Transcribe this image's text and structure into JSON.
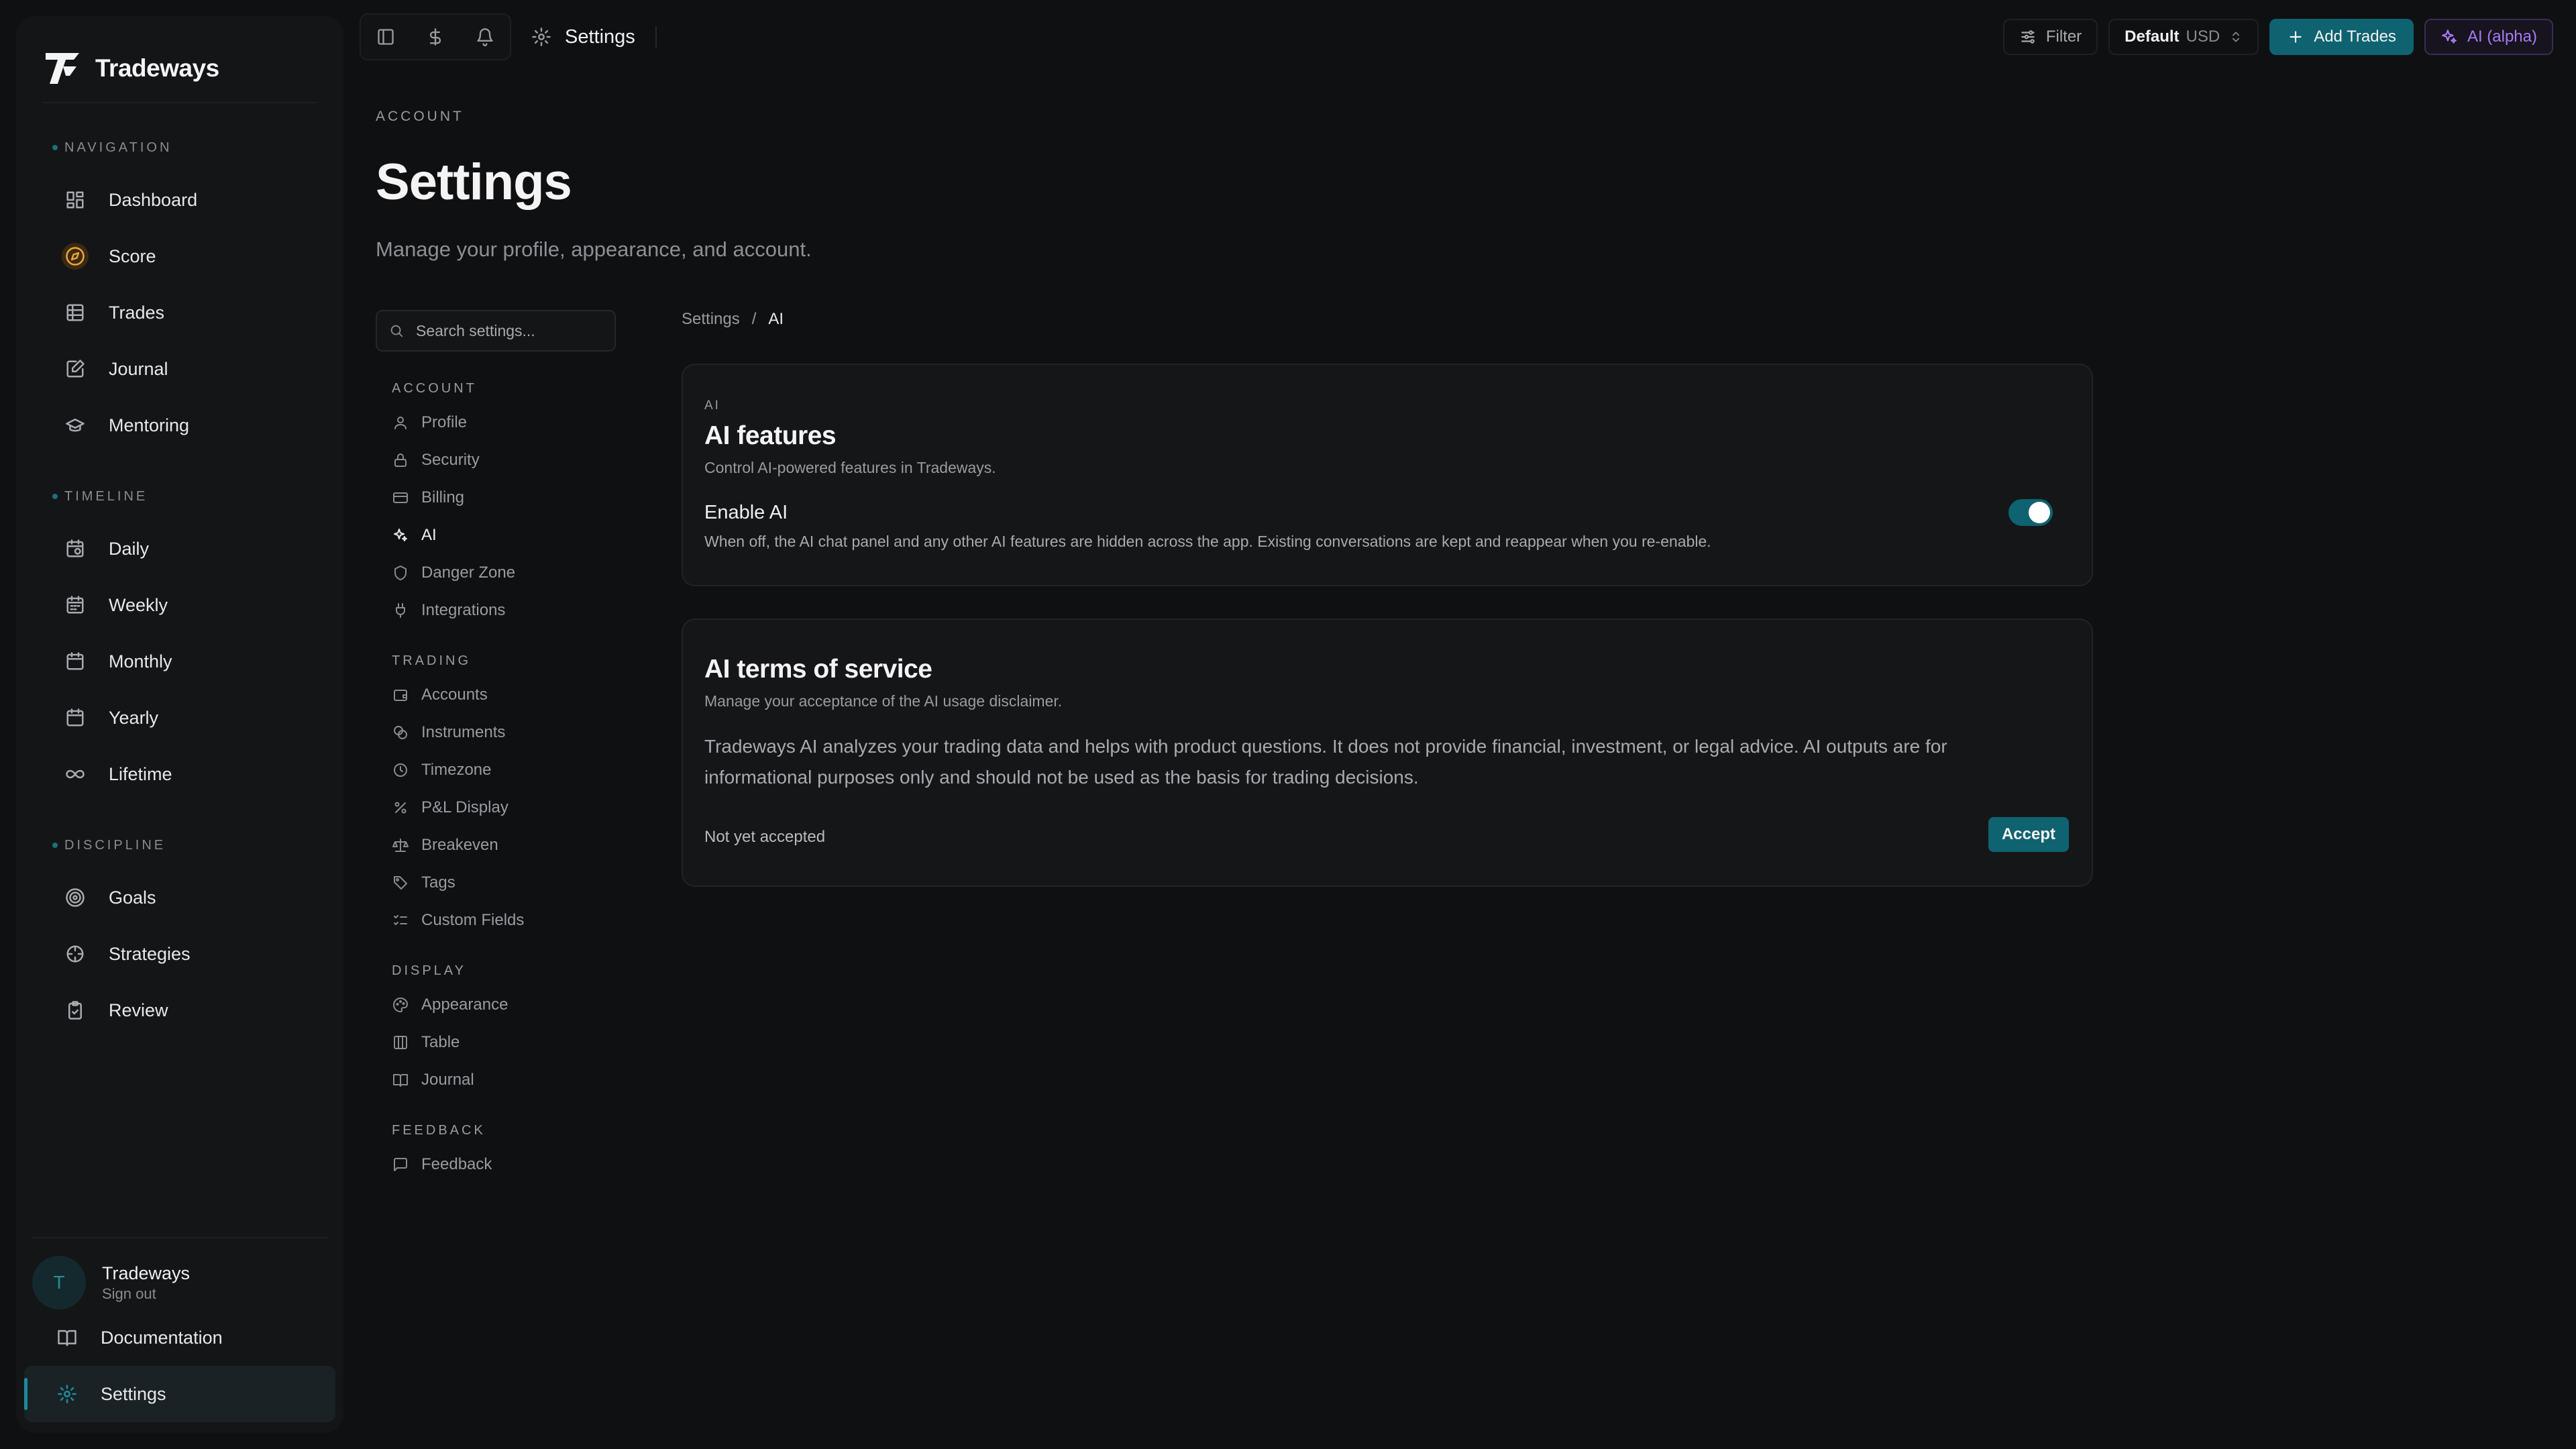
{
  "brand": {
    "name": "Tradeways",
    "accent": "#1f8e9e"
  },
  "sidebar": {
    "sections": [
      {
        "label": "NAVIGATION",
        "items": [
          {
            "label": "Dashboard",
            "icon": "dashboard-icon"
          },
          {
            "label": "Score",
            "icon": "compass-icon",
            "color": "#f0a43a"
          },
          {
            "label": "Trades",
            "icon": "table-icon"
          },
          {
            "label": "Journal",
            "icon": "journal-icon"
          },
          {
            "label": "Mentoring",
            "icon": "graduation-cap-icon"
          }
        ]
      },
      {
        "label": "TIMELINE",
        "items": [
          {
            "label": "Daily",
            "icon": "calendar-clock-icon"
          },
          {
            "label": "Weekly",
            "icon": "calendar-icon"
          },
          {
            "label": "Monthly",
            "icon": "calendar-icon"
          },
          {
            "label": "Yearly",
            "icon": "calendar-icon"
          },
          {
            "label": "Lifetime",
            "icon": "infinity-icon"
          }
        ]
      },
      {
        "label": "DISCIPLINE",
        "items": [
          {
            "label": "Goals",
            "icon": "target-icon"
          },
          {
            "label": "Strategies",
            "icon": "crosshair-icon"
          },
          {
            "label": "Review",
            "icon": "clipboard-check-icon"
          }
        ]
      }
    ],
    "user": {
      "avatar_initial": "T",
      "name": "Tradeways",
      "sub": "Sign out"
    },
    "documentation_label": "Documentation",
    "settings_label": "Settings"
  },
  "topbar": {
    "title": "Settings",
    "filter_label": "Filter",
    "account": "Default",
    "currency": "USD",
    "add_label": "Add Trades",
    "ai_label": "AI (alpha)",
    "ai_color": "#a77cf2"
  },
  "header": {
    "overline": "ACCOUNT",
    "title": "Settings",
    "subtitle": "Manage your profile, appearance, and account."
  },
  "settings_nav": {
    "search_placeholder": "Search settings...",
    "groups": [
      {
        "label": "ACCOUNT",
        "items": [
          {
            "label": "Profile",
            "icon": "user-icon"
          },
          {
            "label": "Security",
            "icon": "lock-icon"
          },
          {
            "label": "Billing",
            "icon": "credit-card-icon"
          },
          {
            "label": "AI",
            "icon": "sparkles-icon",
            "selected": true
          },
          {
            "label": "Danger Zone",
            "icon": "shield-icon"
          },
          {
            "label": "Integrations",
            "icon": "plug-icon"
          }
        ]
      },
      {
        "label": "TRADING",
        "items": [
          {
            "label": "Accounts",
            "icon": "wallet-icon"
          },
          {
            "label": "Instruments",
            "icon": "coins-icon"
          },
          {
            "label": "Timezone",
            "icon": "clock-icon"
          },
          {
            "label": "P&L Display",
            "icon": "percent-icon"
          },
          {
            "label": "Breakeven",
            "icon": "scale-icon"
          },
          {
            "label": "Tags",
            "icon": "tag-icon"
          },
          {
            "label": "Custom Fields",
            "icon": "list-checks-icon"
          }
        ]
      },
      {
        "label": "DISPLAY",
        "items": [
          {
            "label": "Appearance",
            "icon": "palette-icon"
          },
          {
            "label": "Table",
            "icon": "columns-icon"
          },
          {
            "label": "Journal",
            "icon": "book-open-icon"
          }
        ]
      },
      {
        "label": "FEEDBACK",
        "items": [
          {
            "label": "Feedback",
            "icon": "message-square-icon"
          }
        ]
      }
    ]
  },
  "breadcrumb": {
    "root": "Settings",
    "sep": "/",
    "current": "AI"
  },
  "ai_card": {
    "overline": "AI",
    "title": "AI features",
    "subtitle": "Control AI-powered features in Tradeways.",
    "toggle_label": "Enable AI",
    "toggle_desc": "When off, the AI chat panel and any other AI features are hidden across the app. Existing conversations are kept and reappear when you re-enable.",
    "enabled": true
  },
  "tos_card": {
    "title": "AI terms of service",
    "subtitle": "Manage your acceptance of the AI usage disclaimer.",
    "body": "Tradeways AI analyzes your trading data and helps with product questions. It does not provide financial, investment, or legal advice. AI outputs are for informational purposes only and should not be used as the basis for trading decisions.",
    "status": "Not yet accepted",
    "accept_label": "Accept"
  }
}
